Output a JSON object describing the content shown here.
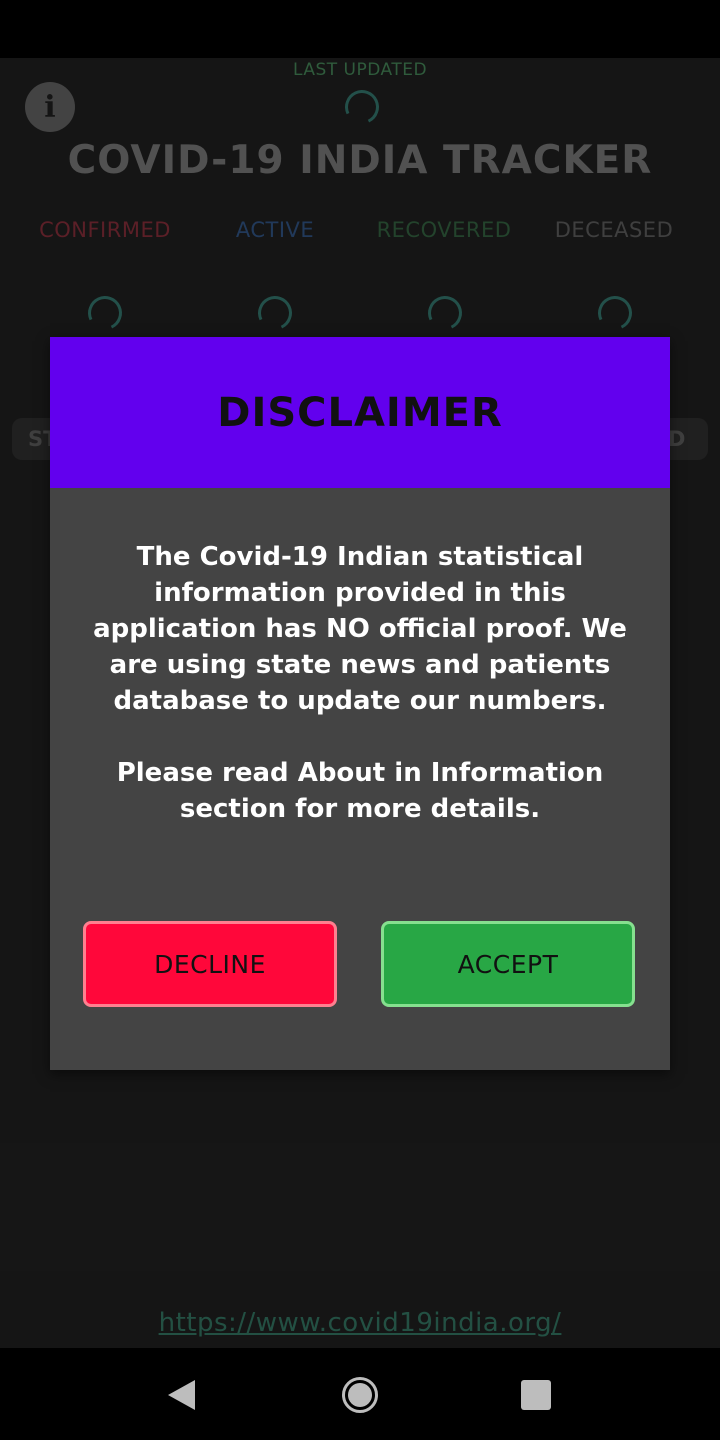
{
  "app": {
    "last_updated_label": "LAST UPDATED",
    "title": "COVID-19 INDIA TRACKER",
    "stats": [
      {
        "label": "CONFIRMED",
        "color": "#7a2a35"
      },
      {
        "label": "ACTIVE",
        "color": "#2d4d78"
      },
      {
        "label": "RECOVERED",
        "color": "#2f5a3b"
      },
      {
        "label": "DECEASED",
        "color": "#555555"
      }
    ],
    "tab_left_partial": "ST",
    "tab_right_partial": "D",
    "source_link": "https://www.covid19india.org/"
  },
  "dialog": {
    "title": "DISCLAIMER",
    "body_paragraph_1": "The Covid-19 Indian statistical information provided in this application has NO official proof. We are using state news and patients database to update our numbers.",
    "body_paragraph_2": "Please read About in Information section for more details.",
    "decline_label": "DECLINE",
    "accept_label": "ACCEPT",
    "header_color": "#6200ee",
    "decline_color": "#ff073a",
    "accept_color": "#28a745"
  },
  "icons": {
    "info": "info-icon",
    "back": "back-icon",
    "home": "home-icon",
    "recents": "recents-icon"
  }
}
